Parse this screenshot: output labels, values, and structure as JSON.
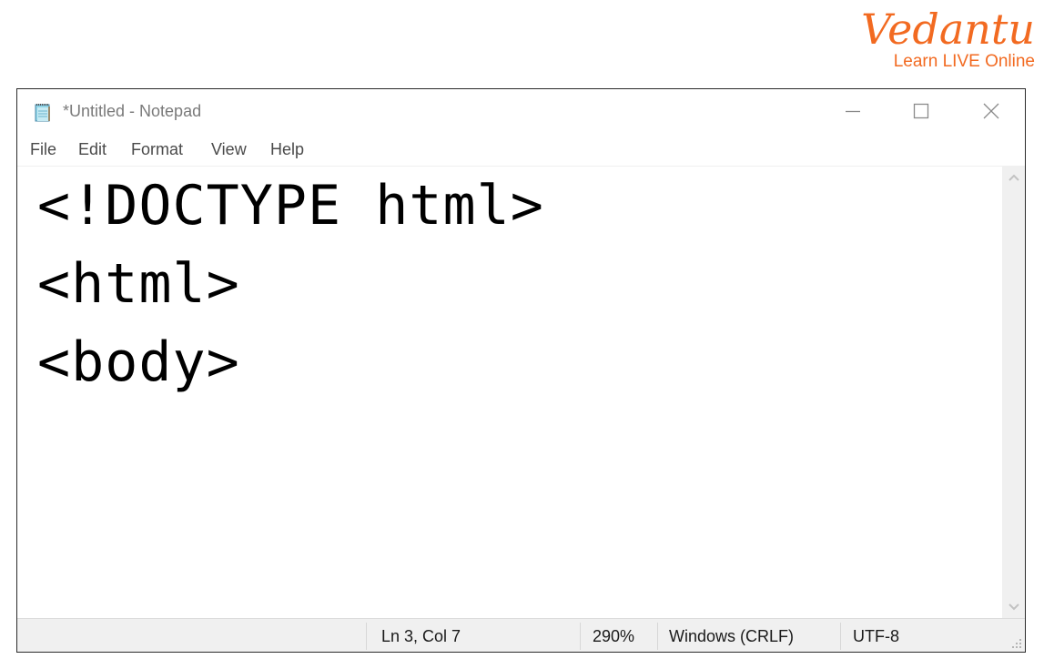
{
  "brand": {
    "name": "Vedantu",
    "tagline": "Learn LIVE Online",
    "color": "#f26a21"
  },
  "window": {
    "title": "*Untitled - Notepad",
    "icon": "notepad-icon",
    "controls": {
      "minimize": "minimize-icon",
      "maximize": "maximize-icon",
      "close": "close-icon"
    }
  },
  "menu": {
    "items": [
      {
        "label": "File"
      },
      {
        "label": "Edit"
      },
      {
        "label": "Format"
      },
      {
        "label": "View"
      },
      {
        "label": "Help"
      }
    ]
  },
  "editor": {
    "lines": [
      "<!DOCTYPE html>",
      "<html>",
      "<body>"
    ]
  },
  "statusbar": {
    "position": "Ln 3, Col 7",
    "zoom": "290%",
    "line_ending": "Windows (CRLF)",
    "encoding": "UTF-8"
  }
}
